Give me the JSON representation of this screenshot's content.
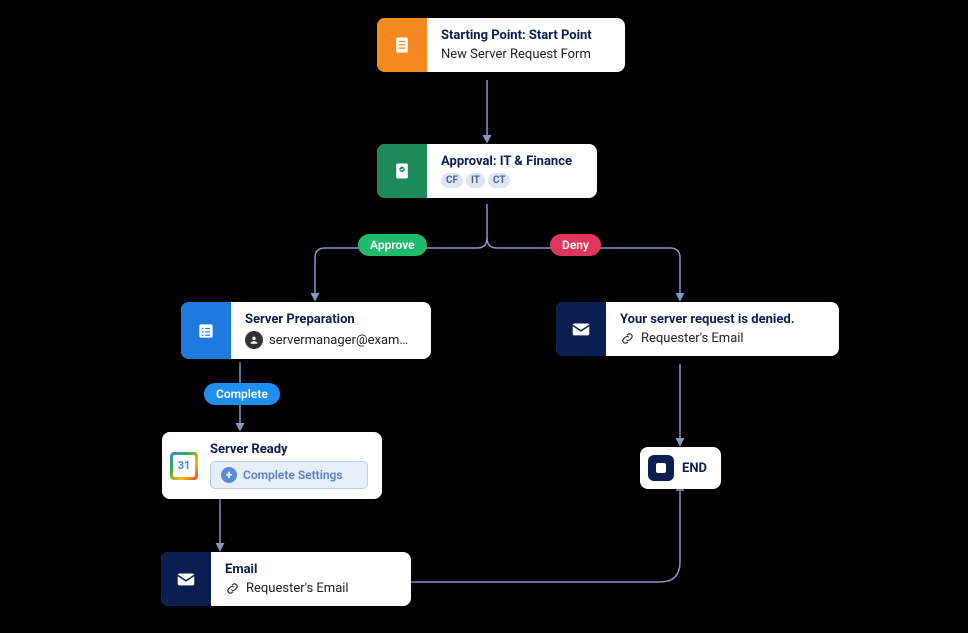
{
  "nodes": {
    "start": {
      "title": "Starting Point: Start Point",
      "subtitle": "New Server Request Form",
      "icon_color": "#f58a1f"
    },
    "approval": {
      "title": "Approval: IT & Finance",
      "icon_color": "#1d8a5a",
      "badges": [
        "CF",
        "IT",
        "CT"
      ]
    },
    "server_prep": {
      "title": "Server Preparation",
      "assignee": "servermanager@exam…",
      "icon_color": "#1f7ae0"
    },
    "denied": {
      "title": "Your server request is denied.",
      "link": "Requester's Email",
      "icon_color": "#0a1e52"
    },
    "server_ready": {
      "title": "Server Ready",
      "button": "Complete Settings",
      "cal_day": "31"
    },
    "email": {
      "title": "Email",
      "link": "Requester's Email",
      "icon_color": "#0a1e52"
    },
    "end": {
      "label": "END"
    }
  },
  "pills": {
    "approve": "Approve",
    "deny": "Deny",
    "complete": "Complete"
  }
}
